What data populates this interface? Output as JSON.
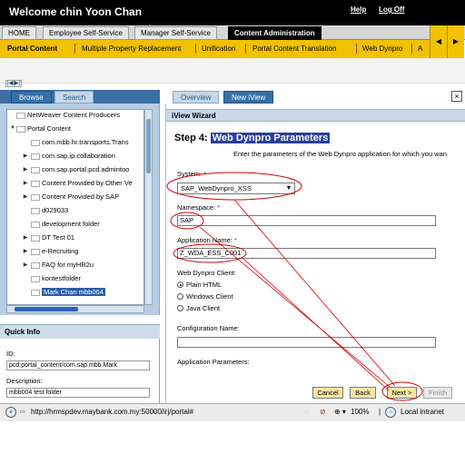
{
  "masthead": {
    "title": "Welcome chin Yoon Chan",
    "help": "Help",
    "logoff": "Log Off"
  },
  "tlnav": [
    "HOME",
    "Employee Self-Service",
    "Manager Self-Service",
    "Content Administration"
  ],
  "subnav": [
    "Portal Content",
    "Multiple Property Replacement",
    "Unification",
    "Portal Content Translation",
    "Web Dynpro",
    "A"
  ],
  "arrows": {
    "left": "◀",
    "right": "▶"
  },
  "collapse": "|◀|▶|",
  "left_tabs": {
    "browse": "Browse",
    "search": "Search"
  },
  "tree": [
    {
      "label": "NetWeaver Content Producers",
      "twisty": "",
      "top": true
    },
    {
      "label": "Portal Content",
      "twisty": "▼",
      "top": true
    },
    {
      "label": "com.mbb.hr.transports.Trans",
      "twisty": ""
    },
    {
      "label": "com.sap.ip.collaboration",
      "twisty": "▶"
    },
    {
      "label": "com.sap.portal.pcd.admintoo",
      "twisty": "▶"
    },
    {
      "label": "Content Provided by Other Ve",
      "twisty": "▶"
    },
    {
      "label": "Content Provided by SAP",
      "twisty": "▶"
    },
    {
      "label": "d029033",
      "twisty": ""
    },
    {
      "label": "development folder",
      "twisty": ""
    },
    {
      "label": "DT Test 01",
      "twisty": "▶"
    },
    {
      "label": "e-Recruiting",
      "twisty": "▶"
    },
    {
      "label": "FAQ for myHR2u",
      "twisty": "▶"
    },
    {
      "label": "kontestfolder",
      "twisty": ""
    },
    {
      "label": "Mark Chan mbb004",
      "twisty": "",
      "selected": true
    }
  ],
  "quick_info": {
    "heading": "Quick Info",
    "id_label": "ID:",
    "id_value": "pcd:portal_content/com.sap.mbb.Mark",
    "desc_label": "Description:",
    "desc_value": "mbb004 test folder"
  },
  "right_tabs": {
    "overview": "Overview",
    "new": "New iView"
  },
  "close": "×",
  "wizard": {
    "header": "iView Wizard",
    "step_prefix": "Step 4:",
    "step_title": "Web Dynpro Parameters",
    "description": "Enter the parameters of the Web Dynpro application for which you wan",
    "system_label": "System:",
    "system_value": "SAP_WebDynpro_XSS",
    "namespace_label": "Namespace:",
    "namespace_value": "SAP",
    "appname_label": "Application Name:",
    "appname_value": "Z_WDA_ESS_C001",
    "client_label": "Web Dynpro Client:",
    "client_options": [
      "Plain HTML",
      "Windows Client",
      "Java Client"
    ],
    "config_label": "Configuration Name:",
    "config_value": "",
    "params_label": "Application Parameters:",
    "required_mark": "*",
    "buttons": {
      "cancel": "Cancel",
      "back": "Back",
      "next": "Next >",
      "finish": "Finish"
    }
  },
  "statusbar": {
    "url": "http://hrmspdev.maybank.com.my:50000/irj/portal#",
    "zoom": "100%",
    "zone": "Local intranet"
  },
  "colors": {
    "brand_yellow": "#f2c100",
    "selection_blue": "#2b5fa5",
    "annotation_red": "#d40000"
  }
}
